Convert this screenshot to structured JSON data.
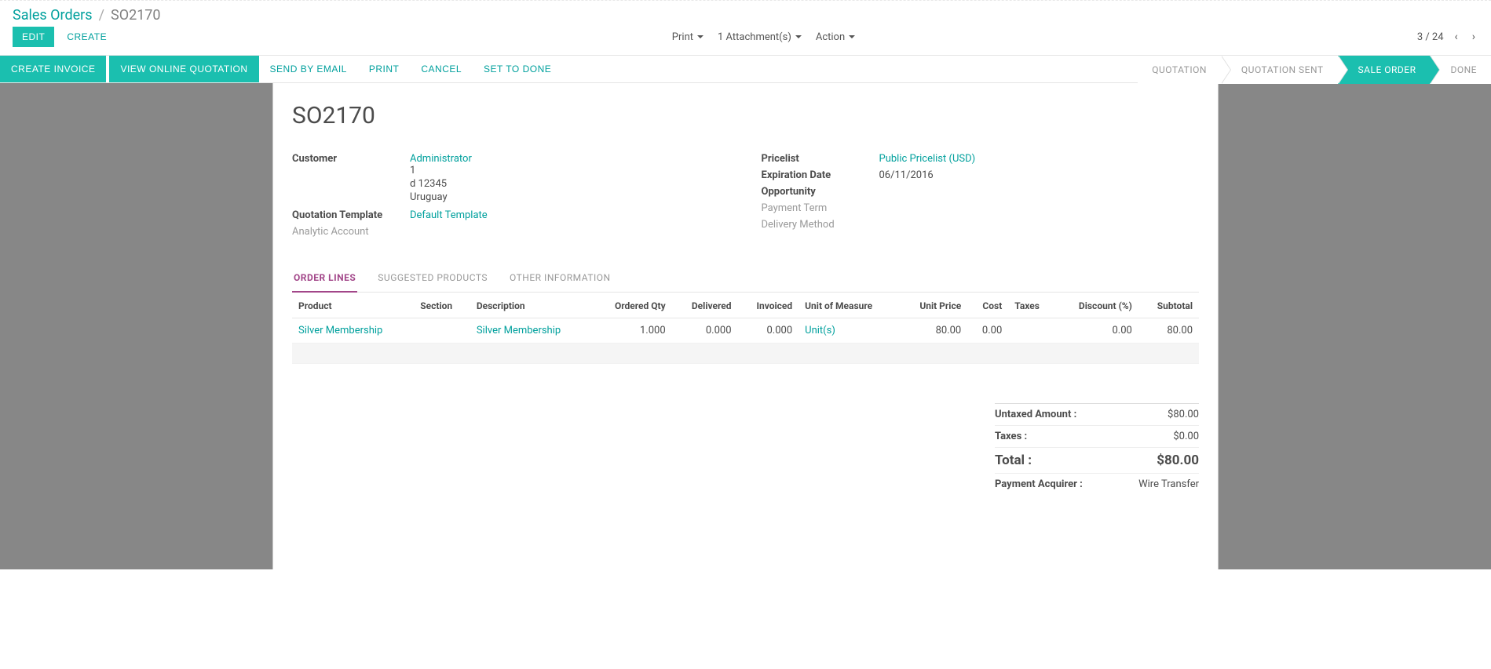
{
  "breadcrumb": {
    "root": "Sales Orders",
    "sep": "/",
    "current": "SO2170"
  },
  "cp_buttons": {
    "edit": "EDIT",
    "create": "CREATE"
  },
  "cp_dropdowns": {
    "print": "Print",
    "attachments": "1 Attachment(s)",
    "action": "Action"
  },
  "pager": {
    "text": "3 / 24"
  },
  "action_bar": {
    "create_invoice": "CREATE INVOICE",
    "view_online": "VIEW ONLINE QUOTATION",
    "send_email": "SEND BY EMAIL",
    "print": "PRINT",
    "cancel": "CANCEL",
    "set_done": "SET TO DONE"
  },
  "status": {
    "quotation": "QUOTATION",
    "quotation_sent": "QUOTATION SENT",
    "sale_order": "SALE ORDER",
    "done": "DONE"
  },
  "record": {
    "name": "SO2170",
    "customer_label": "Customer",
    "customer_name": "Administrator",
    "customer_addr1": "1",
    "customer_addr2": "d 12345",
    "customer_country": "Uruguay",
    "quotation_template_label": "Quotation Template",
    "quotation_template": "Default Template",
    "analytic_account_label": "Analytic Account",
    "pricelist_label": "Pricelist",
    "pricelist": "Public Pricelist (USD)",
    "expiration_label": "Expiration Date",
    "expiration": "06/11/2016",
    "opportunity_label": "Opportunity",
    "payment_term_label": "Payment Term",
    "delivery_method_label": "Delivery Method"
  },
  "tabs": {
    "order_lines": "ORDER LINES",
    "suggested": "SUGGESTED PRODUCTS",
    "other": "OTHER INFORMATION"
  },
  "line_headers": {
    "product": "Product",
    "section": "Section",
    "description": "Description",
    "ordered": "Ordered Qty",
    "delivered": "Delivered",
    "invoiced": "Invoiced",
    "uom": "Unit of Measure",
    "unit_price": "Unit Price",
    "cost": "Cost",
    "taxes": "Taxes",
    "discount": "Discount (%)",
    "subtotal": "Subtotal"
  },
  "lines": [
    {
      "product": "Silver Membership",
      "section": "",
      "description": "Silver Membership",
      "ordered": "1.000",
      "delivered": "0.000",
      "invoiced": "0.000",
      "uom": "Unit(s)",
      "unit_price": "80.00",
      "cost": "0.00",
      "taxes": "",
      "discount": "0.00",
      "subtotal": "80.00"
    }
  ],
  "totals": {
    "untaxed_label": "Untaxed Amount :",
    "untaxed_value": "$80.00",
    "taxes_label": "Taxes :",
    "taxes_value": "$0.00",
    "total_label": "Total :",
    "total_value": "$80.00",
    "payacq_label": "Payment Acquirer :",
    "payacq_value": "Wire Transfer"
  }
}
